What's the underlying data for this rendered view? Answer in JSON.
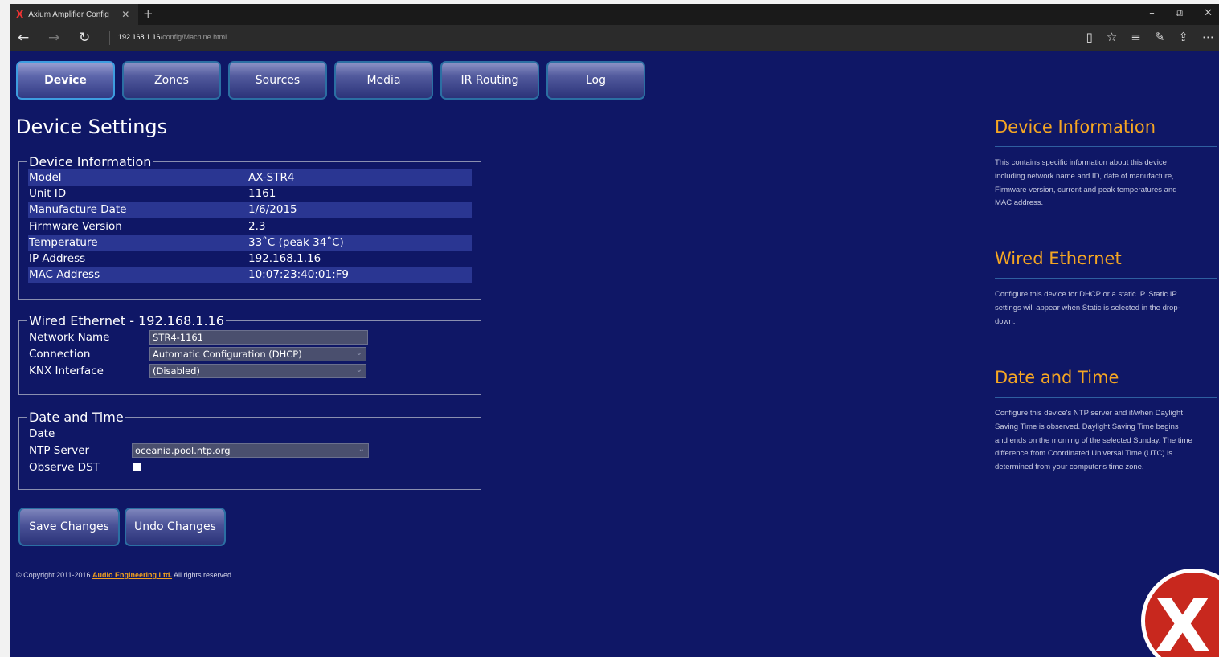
{
  "browser": {
    "tab_title": "Axium Amplifier Config",
    "tab_favicon": "X",
    "tab_close": "✕",
    "new_tab": "+",
    "url_host": "192.168.1.16",
    "url_path": "/config/Machine.html",
    "window_controls": [
      "–",
      "⧉",
      "✕"
    ]
  },
  "nav_tabs": [
    "Device",
    "Zones",
    "Sources",
    "Media",
    "IR Routing",
    "Log"
  ],
  "active_tab": "Device",
  "page_title": "Device Settings",
  "device_info": {
    "legend": "Device Information",
    "rows": [
      {
        "label": "Model",
        "value": "AX-STR4"
      },
      {
        "label": "Unit ID",
        "value": "1161"
      },
      {
        "label": "Manufacture Date",
        "value": "1/6/2015"
      },
      {
        "label": "Firmware Version",
        "value": "2.3"
      },
      {
        "label": "Temperature",
        "value": "33˚C (peak 34˚C)"
      },
      {
        "label": "IP Address",
        "value": "192.168.1.16"
      },
      {
        "label": "MAC Address",
        "value": "10:07:23:40:01:F9"
      }
    ]
  },
  "wired": {
    "legend": "Wired Ethernet - 192.168.1.16",
    "network_name_label": "Network Name",
    "network_name_value": "STR4-1161",
    "connection_label": "Connection",
    "connection_value": "Automatic Configuration (DHCP)",
    "knx_label": "KNX Interface",
    "knx_value": "(Disabled)"
  },
  "datetime": {
    "legend": "Date and Time",
    "date_label": "Date",
    "ntp_label": "NTP Server",
    "ntp_value": "oceania.pool.ntp.org",
    "dst_label": "Observe DST",
    "dst_checked": false
  },
  "buttons": {
    "save": "Save Changes",
    "undo": "Undo Changes"
  },
  "footer": {
    "prefix": "© Copyright 2011-2016 ",
    "link": "Audio Engineering Ltd.",
    "suffix": " All rights reserved."
  },
  "help": [
    {
      "title": "Device Information",
      "text": "This contains specific information about this device including network name and ID, date of manufacture, Firmware version, current and peak temperatures and MAC address."
    },
    {
      "title": "Wired Ethernet",
      "text": "Configure this device for DHCP or a static IP. Static IP settings will appear when Static is selected in the drop-down."
    },
    {
      "title": "Date and Time",
      "text": "Configure this device's NTP server and if/when Daylight Saving Time is observed. Daylight Saving Time begins and ends on the morning of the selected Sunday. The time difference from Coordinated Universal Time (UTC) is determined from your computer's time zone."
    }
  ],
  "colors": {
    "page_bg": "#0f1766",
    "help_title": "#f5a623",
    "row_shade": "#2a3692",
    "tab_border": "#2b6fa3",
    "logo_red": "#c8281e"
  },
  "logo_text": "X"
}
